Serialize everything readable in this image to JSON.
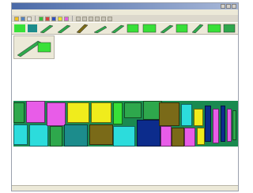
{
  "window": {
    "title": ""
  },
  "menubar": {
    "items": [
      "",
      "",
      "",
      "",
      "",
      "",
      "",
      ""
    ]
  },
  "statusbar": {
    "text": ""
  },
  "colors": {
    "magenta": "#e85ce8",
    "yellow": "#f0ec1c",
    "teal": "#1c8c8c",
    "green": "#2ea84c",
    "lime": "#38e038",
    "olive": "#7a6a18",
    "cyan": "#2cdcdc",
    "navy": "#0c2c8c"
  }
}
